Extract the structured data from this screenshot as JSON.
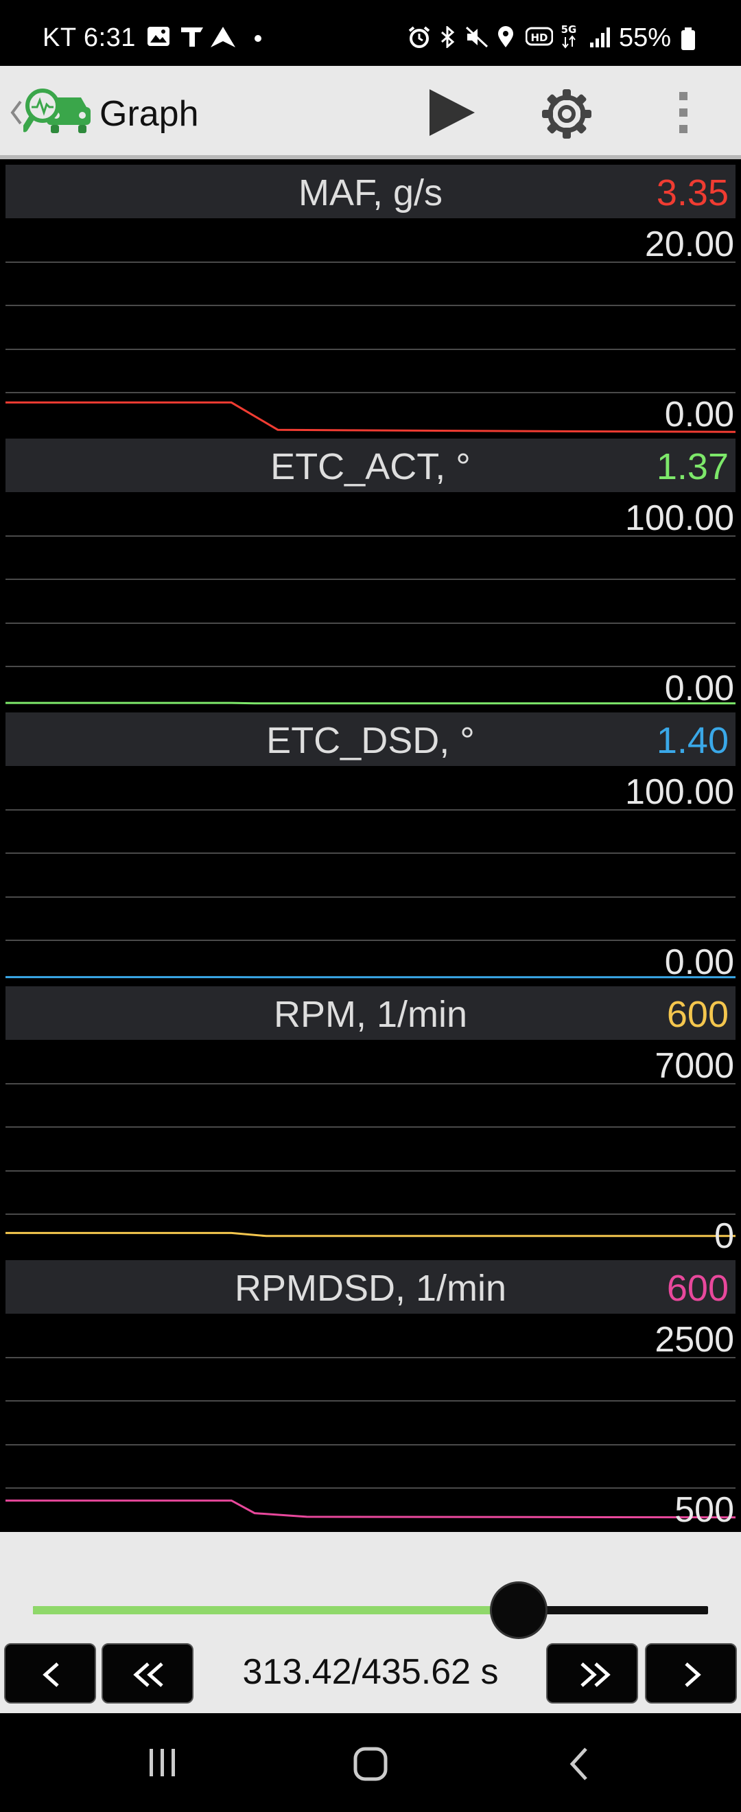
{
  "status_bar": {
    "time": "KT 6:31",
    "battery": "55%",
    "icons": [
      "gallery-icon",
      "t-icon",
      "navigation-icon",
      "dot-icon",
      "alarm-icon",
      "bluetooth-icon",
      "mute-icon",
      "location-icon",
      "hd-icon",
      "5g-icon",
      "signal-icon",
      "battery-icon"
    ]
  },
  "toolbar": {
    "title": "Graph",
    "icons": [
      "back-icon",
      "car-diagnostic-icon",
      "play-icon",
      "gear-icon",
      "more-vert-icon"
    ]
  },
  "colors": {
    "maf": "#f03c32",
    "etc_act": "#7de86a",
    "etc_dsd": "#3aa8e8",
    "rpm": "#f4c64e",
    "rpmdsd": "#e8489c",
    "slider_fill": "#8fd86a"
  },
  "panels": [
    {
      "id": "maf",
      "name": "MAF, g/s",
      "value": "3.35",
      "max_label": "20.00",
      "min_label": "0.00"
    },
    {
      "id": "etc_act",
      "name": "ETC_ACT, °",
      "value": "1.37",
      "max_label": "100.00",
      "min_label": "0.00"
    },
    {
      "id": "etc_dsd",
      "name": "ETC_DSD, °",
      "value": "1.40",
      "max_label": "100.00",
      "min_label": "0.00"
    },
    {
      "id": "rpm",
      "name": "RPM, 1/min",
      "value": "600",
      "max_label": "7000",
      "min_label": "0"
    },
    {
      "id": "rpmdsd",
      "name": "RPMDSD, 1/min",
      "value": "600",
      "max_label": "2500",
      "min_label": "500"
    }
  ],
  "chart_data": [
    {
      "type": "line",
      "title": "MAF, g/s",
      "ylim": [
        0,
        20
      ],
      "grid": true,
      "x": [
        0,
        195,
        235,
        300,
        500,
        630
      ],
      "series": [
        {
          "values": [
            2.85,
            2.85,
            0.25,
            0.2,
            0.1,
            0.05
          ]
        }
      ]
    },
    {
      "type": "line",
      "title": "ETC_ACT, °",
      "ylim": [
        0,
        100
      ],
      "grid": true,
      "x": [
        0,
        195,
        215,
        630
      ],
      "series": [
        {
          "values": [
            1.6,
            1.6,
            1.37,
            1.37
          ]
        }
      ]
    },
    {
      "type": "line",
      "title": "ETC_DSD, °",
      "ylim": [
        0,
        100
      ],
      "grid": true,
      "x": [
        0,
        195,
        215,
        630
      ],
      "series": [
        {
          "values": [
            1.45,
            1.45,
            1.4,
            1.4
          ]
        }
      ]
    },
    {
      "type": "line",
      "title": "RPM, 1/min",
      "ylim": [
        0,
        7000
      ],
      "grid": true,
      "x": [
        0,
        195,
        225,
        630
      ],
      "series": [
        {
          "values": [
            700,
            700,
            600,
            600
          ]
        }
      ]
    },
    {
      "type": "line",
      "title": "RPMDSD, 1/min",
      "ylim": [
        500,
        2500
      ],
      "grid": true,
      "x": [
        0,
        195,
        215,
        260,
        630
      ],
      "series": [
        {
          "values": [
            760,
            760,
            640,
            605,
            600
          ]
        }
      ]
    }
  ],
  "playback": {
    "position_fraction": 0.7194,
    "time_readout": "313.42/435.62 s",
    "buttons": [
      "prev-button",
      "rewind-button",
      "fast-forward-button",
      "next-button"
    ]
  }
}
